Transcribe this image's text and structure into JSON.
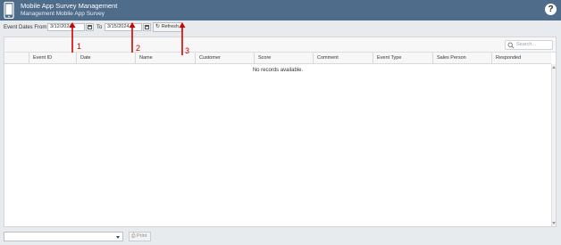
{
  "header": {
    "title": "Mobile App Survey Management",
    "subtitle": "Management Mobile App Survey",
    "help_label": "?",
    "app_icon": "phone-icon",
    "background": "#4f6d8b"
  },
  "filter": {
    "from_label": "Event Dates From",
    "from_value": "3/12/2024",
    "to_label": "To",
    "to_value": "3/15/2024",
    "refresh_label": "Refresh",
    "refresh_icon": "refresh-icon",
    "calendar_icon": "calendar-icon"
  },
  "grid": {
    "search_placeholder": "Search...",
    "columns": [
      "Event ID",
      "Date",
      "Name",
      "Customer",
      "Score",
      "Comment",
      "Event Type",
      "Sales Person",
      "Responded"
    ],
    "empty_text": "No records available."
  },
  "footer": {
    "select_value": "",
    "print_label": "Print",
    "print_icon": "printer-icon"
  },
  "annotations": [
    "1",
    "2",
    "3"
  ],
  "annotation_color": "#d40000"
}
